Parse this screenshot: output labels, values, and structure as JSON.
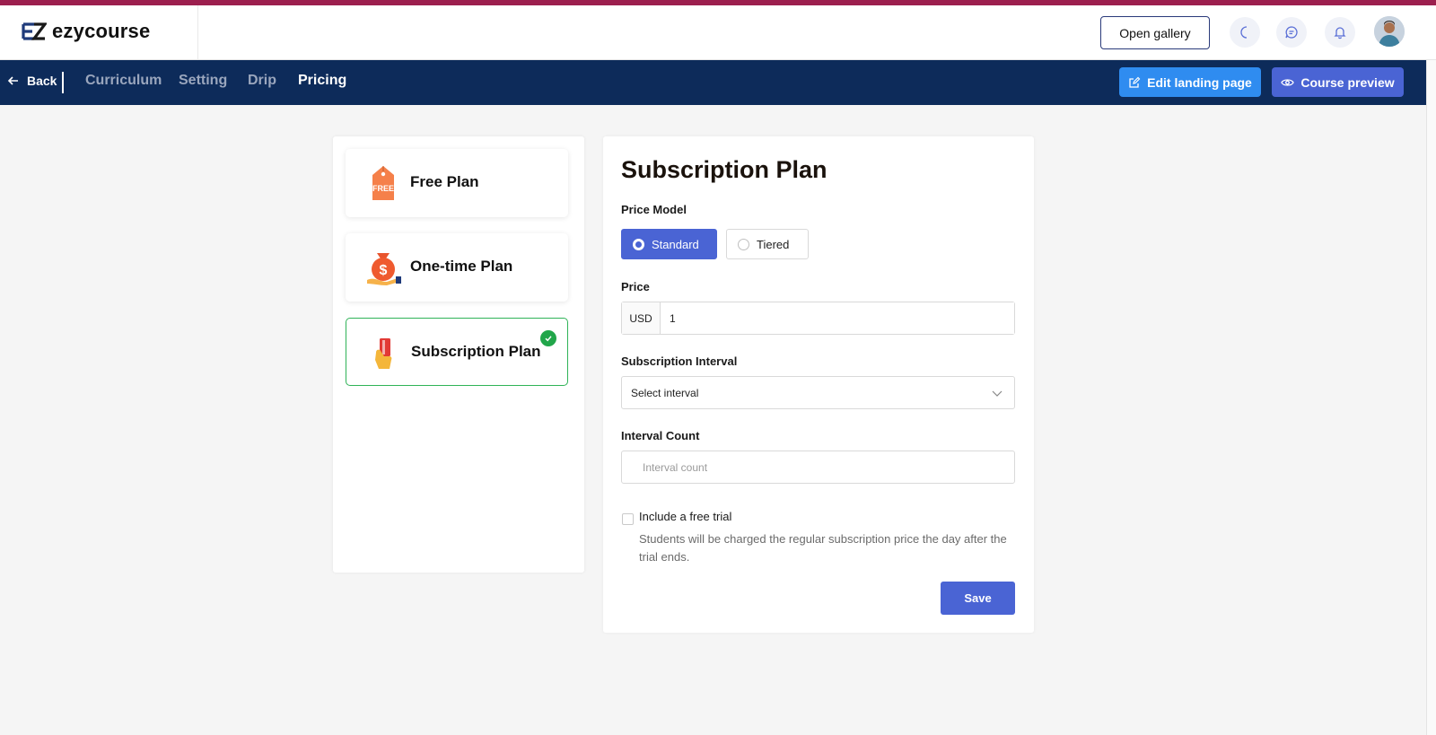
{
  "brand": {
    "name": "ezycourse",
    "primary": "#0d2b5a",
    "accent": "#4a64d4",
    "strip": "#9c1f4e"
  },
  "header": {
    "gallery_label": "Open gallery",
    "icons": [
      "moon-icon",
      "chat-icon",
      "bell-icon"
    ]
  },
  "nav": {
    "back_label": "Back",
    "items": [
      {
        "label": "Curriculum",
        "active": false
      },
      {
        "label": "Setting",
        "active": false
      },
      {
        "label": "Drip",
        "active": false
      },
      {
        "label": "Pricing",
        "active": true
      }
    ],
    "edit_landing_label": "Edit landing page",
    "course_preview_label": "Course preview"
  },
  "plans": [
    {
      "label": "Free Plan",
      "icon": "free-tag-icon",
      "selected": false
    },
    {
      "label": "One-time Plan",
      "icon": "money-bag-icon",
      "selected": false
    },
    {
      "label": "Subscription Plan",
      "icon": "card-in-hand-icon",
      "selected": true
    }
  ],
  "form": {
    "title": "Subscription Plan",
    "price_model_label": "Price Model",
    "price_model_options": [
      {
        "label": "Standard",
        "selected": true
      },
      {
        "label": "Tiered",
        "selected": false
      }
    ],
    "price_label": "Price",
    "currency": "USD",
    "price_value": "1",
    "interval_label": "Subscription Interval",
    "interval_placeholder": "Select interval",
    "interval_count_label": "Interval Count",
    "interval_count_placeholder": "Interval count",
    "free_trial_label": "Include a free trial",
    "free_trial_checked": false,
    "free_trial_help": "Students will be charged the regular subscription price the day after the trial ends.",
    "save_label": "Save"
  }
}
